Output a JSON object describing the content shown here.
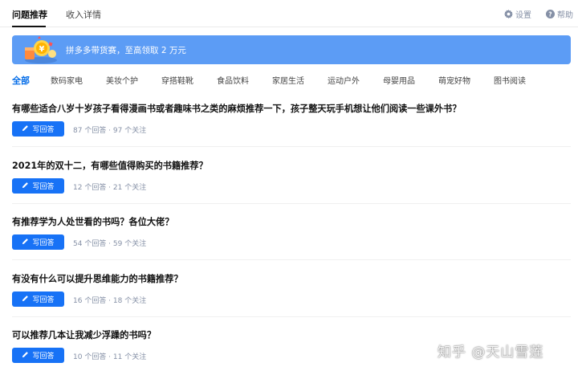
{
  "header": {
    "tabs": [
      {
        "label": "问题推荐",
        "active": true
      },
      {
        "label": "收入详情",
        "active": false
      }
    ],
    "settings_label": "设置",
    "help_label": "帮助"
  },
  "banner": {
    "text": "拼多多带货赛，至高领取 2 万元",
    "color": "#5c9cf5"
  },
  "categories": [
    "全部",
    "数码家电",
    "美妆个护",
    "穿搭鞋靴",
    "食品饮料",
    "家居生活",
    "运动户外",
    "母婴用品",
    "萌宠好物",
    "图书阅读"
  ],
  "questions": [
    {
      "title": "有哪些适合八岁十岁孩子看得漫画书或者趣味书之类的麻烦推荐一下，孩子整天玩手机想让他们阅读一些课外书？",
      "button": "写回答",
      "meta": "87 个回答 · 97 个关注"
    },
    {
      "title": "2021年的双十二，有哪些值得购买的书籍推荐？",
      "button": "写回答",
      "meta": "12 个回答 · 21 个关注"
    },
    {
      "title": "有推荐学为人处世看的书吗？各位大佬？",
      "button": "写回答",
      "meta": "54 个回答 · 59 个关注"
    },
    {
      "title": "有没有什么可以提升思维能力的书籍推荐？",
      "button": "写回答",
      "meta": "16 个回答 · 18 个关注"
    },
    {
      "title": "可以推荐几本让我减少浮躁的书吗？",
      "button": "写回答",
      "meta": "10 个回答 · 11 个关注"
    }
  ],
  "watermark": "知乎 @天山雪莲",
  "colors": {
    "accent": "#056de8",
    "button": "#1772f6",
    "muted": "#8590a6"
  }
}
